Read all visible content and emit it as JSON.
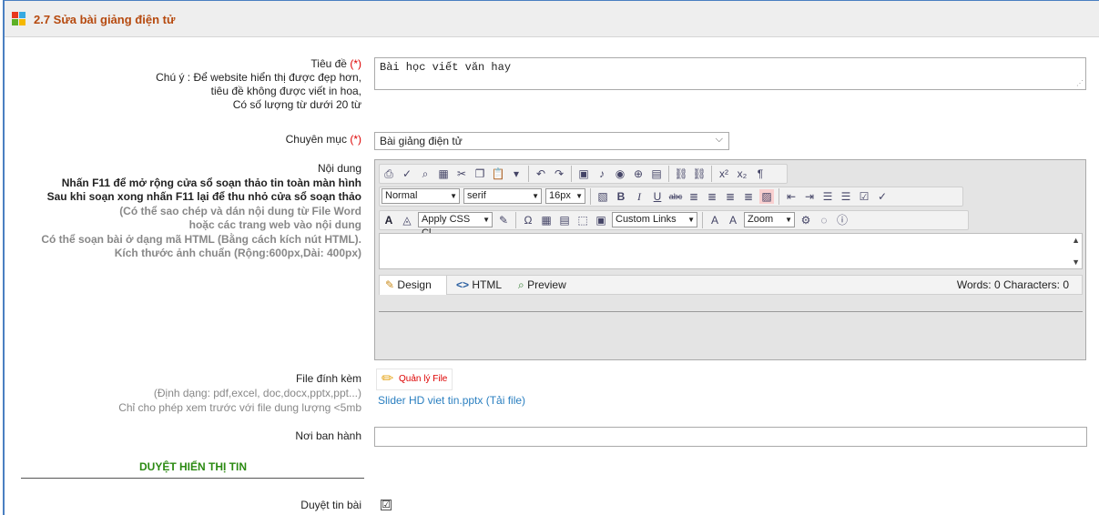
{
  "header": {
    "title": "2.7 Sửa bài giảng điện tử"
  },
  "title_field": {
    "label": "Tiêu đề",
    "required_mark": "(*)",
    "note_lines": [
      "Chú ý : Để website hiển thị được đẹp hơn,",
      "tiêu đề không được viết in hoa,",
      "Có số lượng từ dưới 20 từ"
    ],
    "value": "Bài học viết văn hay"
  },
  "category_field": {
    "label": "Chuyên mục",
    "required_mark": "(*)",
    "value": "Bài giảng điện tử"
  },
  "content_field": {
    "label": "Nội dung",
    "notes_bold": [
      "Nhấn F11 để mở rộng cửa sổ soạn thảo tin toàn màn hình",
      "Sau khi soạn xong nhấn F11 lại để thu nhỏ cửa sổ soạn thảo"
    ],
    "notes_grey": [
      "(Có thể sao chép và dán nội dung từ File Word",
      "hoặc các trang web vào nội dung",
      "Có thể soạn bài ở dạng mã HTML (Bằng cách kích nút HTML).",
      "Kích thước ảnh chuẩn (Rộng:600px,Dài: 400px)"
    ]
  },
  "editor": {
    "format": "Normal",
    "font": "serif",
    "size": "16px",
    "css_class": "Apply CSS Cl...",
    "custom_links": "Custom Links",
    "zoom": "Zoom",
    "tabs": {
      "design": "Design",
      "html": "HTML",
      "preview": "Preview"
    },
    "counts": "Words: 0  Characters: 0"
  },
  "attachment": {
    "label": "File đính kèm",
    "notes": [
      "(Định dạng: pdf,excel, doc,docx,pptx,ppt...)",
      "Chỉ cho phép xem trước với file dung lượng <5mb"
    ],
    "manager_button": "Quản lý File",
    "file_link": "Slider HD viet tin.pptx (Tải file)"
  },
  "issuer_field": {
    "label": "Nơi ban hành",
    "value": ""
  },
  "approval": {
    "heading": "DUYỆT HIỂN THỊ TIN",
    "checkbox_label": "Duyệt tin bài",
    "checked": "☑"
  }
}
